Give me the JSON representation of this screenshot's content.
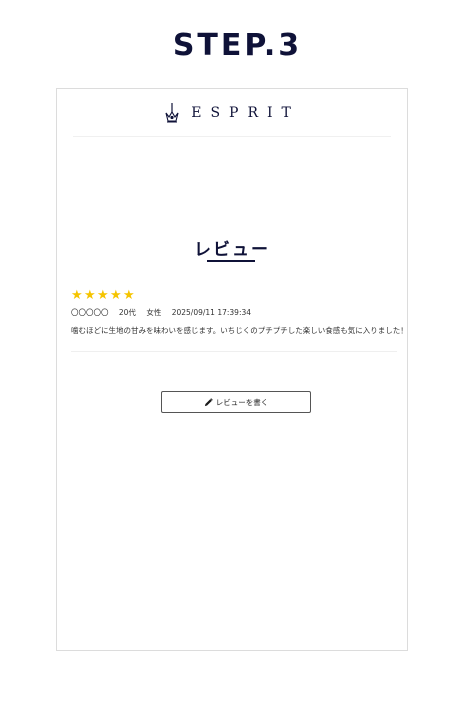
{
  "step": {
    "title": "STEP.3"
  },
  "brand": {
    "name": "ESPRIT",
    "logo_icon": "crown-monogram-icon"
  },
  "section": {
    "title": "レビュー"
  },
  "review": {
    "rating": 5,
    "rating_max": 5,
    "name": "〇〇〇〇〇",
    "age": "20代",
    "gender": "女性",
    "datetime": "2025/09/11 17:39:34",
    "text": "噛むほどに生地の甘みを味わいを感じます。いちじくのプチプチした楽しい食感も気に入りました！"
  },
  "actions": {
    "write_review_label": "レビューを書く",
    "write_review_icon": "pencil-icon"
  },
  "colors": {
    "navy": "#0f1238",
    "star": "#f5c400",
    "border": "#dcdcdc"
  }
}
